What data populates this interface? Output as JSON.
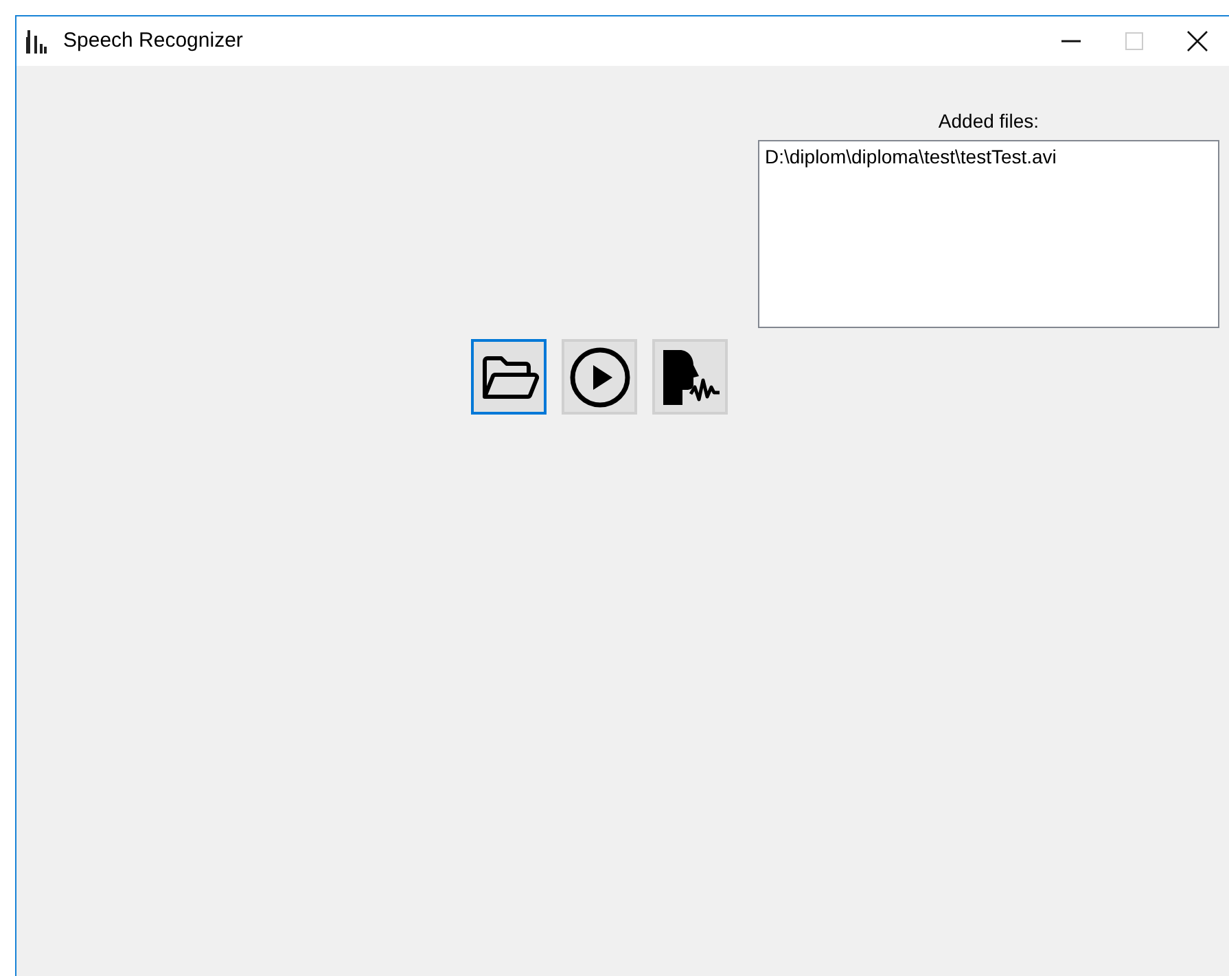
{
  "window": {
    "title": "Speech Recognizer",
    "controls": [
      {
        "kind": "minimize",
        "disabled": false
      },
      {
        "kind": "maximize",
        "disabled": true
      },
      {
        "kind": "close",
        "disabled": false
      }
    ]
  },
  "files": {
    "label": "Added files:",
    "items": [
      "D:\\diplom\\diploma\\test\\testTest.avi"
    ]
  },
  "toolbar": [
    {
      "kind": "open",
      "focused": true
    },
    {
      "kind": "play",
      "focused": false
    },
    {
      "kind": "recognize",
      "focused": false
    }
  ]
}
